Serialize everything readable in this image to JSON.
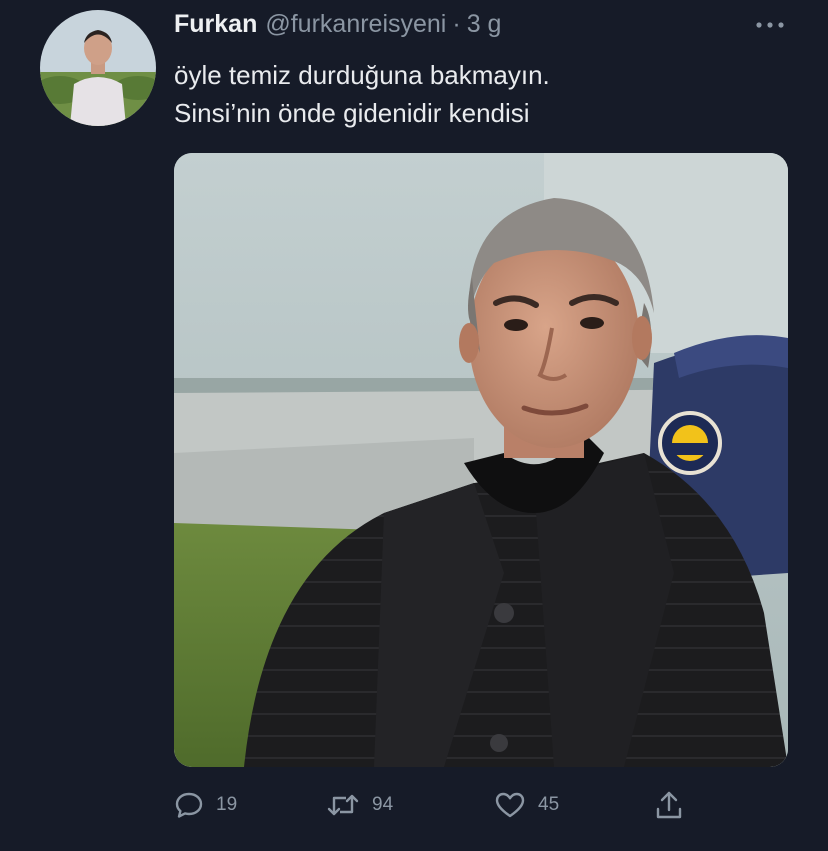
{
  "author": {
    "display_name": "Furkan",
    "handle": "@furkanreisyeni",
    "separator": "·",
    "time": "3 g"
  },
  "tweet": {
    "lines": [
      "öyle temiz durduğuna bakmayın.",
      "Sinsi’nin önde gidenidir kendisi"
    ]
  },
  "actions": {
    "reply_count": "19",
    "retweet_count": "94",
    "like_count": "45"
  },
  "icons": {
    "more": "more-icon",
    "reply": "reply-icon",
    "retweet": "retweet-icon",
    "like": "like-icon",
    "share": "share-icon"
  },
  "colors": {
    "background": "#161b28",
    "text_primary": "#e9ebee",
    "text_secondary": "#8b96a3"
  }
}
